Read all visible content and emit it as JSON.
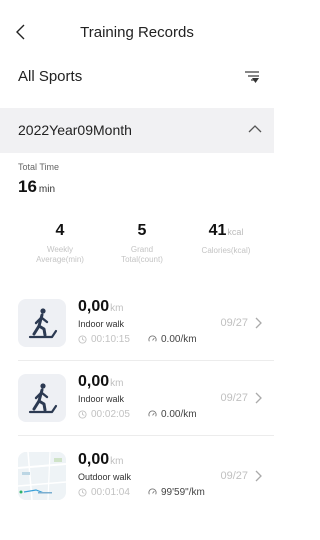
{
  "header": {
    "title": "Training Records",
    "back_icon": "chevron-left-icon"
  },
  "filter": {
    "label": "All Sports",
    "icon": "filter-sort-icon"
  },
  "month": {
    "label": "2022Year09Month",
    "icon": "chevron-up-icon"
  },
  "total_time": {
    "label": "Total Time",
    "value": "16",
    "unit": "min"
  },
  "stats": [
    {
      "value": "4",
      "unit": "",
      "label_line1": "Weekly",
      "label_line2": "Average(min)"
    },
    {
      "value": "5",
      "unit": "",
      "label_line1": "Grand",
      "label_line2": "Total(count)"
    },
    {
      "value": "41",
      "unit": "kcal",
      "label_line1": "",
      "label_line2": "Calories(kcal)"
    }
  ],
  "records": [
    {
      "distance": "0,00",
      "unit": "km",
      "type": "Indoor walk",
      "duration": "00:10:15",
      "pace": "0.00/km",
      "date": "09/27",
      "icon": "treadmill-walker-icon"
    },
    {
      "distance": "0,00",
      "unit": "km",
      "type": "Indoor walk",
      "duration": "00:02:05",
      "pace": "0.00/km",
      "date": "09/27",
      "icon": "treadmill-walker-icon"
    },
    {
      "distance": "0,00",
      "unit": "km",
      "type": "Outdoor walk",
      "duration": "00:01:04",
      "pace": "99'59\"/km",
      "date": "09/27",
      "icon": "map-thumbnail-icon"
    }
  ],
  "colors": {
    "accent_icon": "#2c3a52",
    "band": "#f1f1f3",
    "muted": "#c0c0c0"
  }
}
